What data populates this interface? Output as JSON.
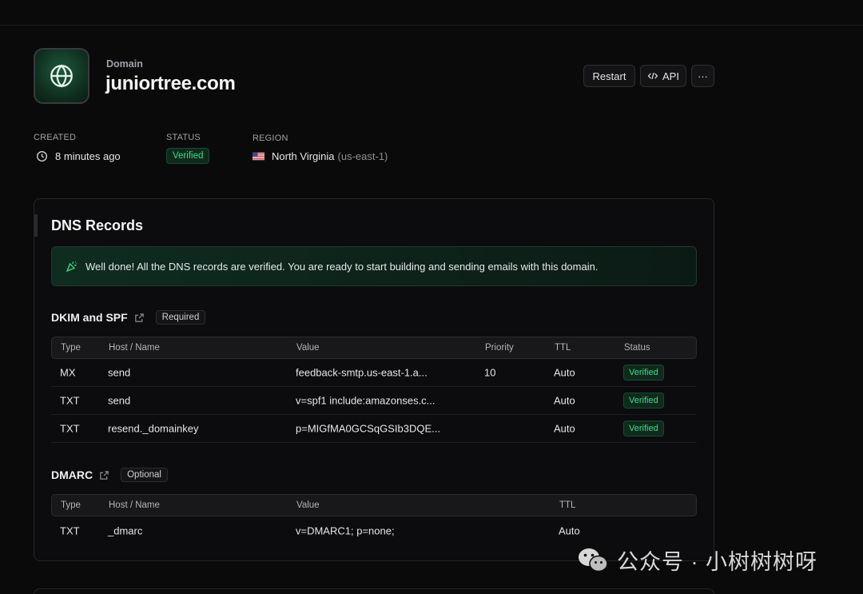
{
  "header": {
    "eyebrow": "Domain",
    "title": "juniortree.com",
    "icon": "globe-icon",
    "buttons": {
      "restart": "Restart",
      "api": "API",
      "more": "···"
    }
  },
  "meta": {
    "created_label": "CREATED",
    "created_value": "8 minutes ago",
    "status_label": "STATUS",
    "status_value": "Verified",
    "region_label": "REGION",
    "region_value": "North Virginia",
    "region_code": "(us-east-1)"
  },
  "dns": {
    "title": "DNS Records",
    "alert": "Well done! All the DNS records are verified. You are ready to start building and sending emails with this domain.",
    "dkim": {
      "title": "DKIM and SPF",
      "badge": "Required",
      "columns": [
        "Type",
        "Host / Name",
        "Value",
        "Priority",
        "TTL",
        "Status"
      ],
      "rows": [
        {
          "type": "MX",
          "host": "send",
          "value": "feedback-smtp.us-east-1.a...",
          "priority": "10",
          "ttl": "Auto",
          "status": "Verified"
        },
        {
          "type": "TXT",
          "host": "send",
          "value": "v=spf1 include:amazonses.c...",
          "priority": "",
          "ttl": "Auto",
          "status": "Verified"
        },
        {
          "type": "TXT",
          "host": "resend._domainkey",
          "value": "p=MIGfMA0GCSqGSIb3DQE...",
          "priority": "",
          "ttl": "Auto",
          "status": "Verified"
        }
      ]
    },
    "dmarc": {
      "title": "DMARC",
      "badge": "Optional",
      "columns": [
        "Type",
        "Host / Name",
        "Value",
        "TTL"
      ],
      "rows": [
        {
          "type": "TXT",
          "host": "_dmarc",
          "value": "v=DMARC1; p=none;",
          "ttl": "Auto"
        }
      ]
    }
  },
  "watermark": "公众号 · 小树树树呀",
  "colors": {
    "accent_green": "#3ddc8a",
    "background": "#0a0a0b"
  }
}
